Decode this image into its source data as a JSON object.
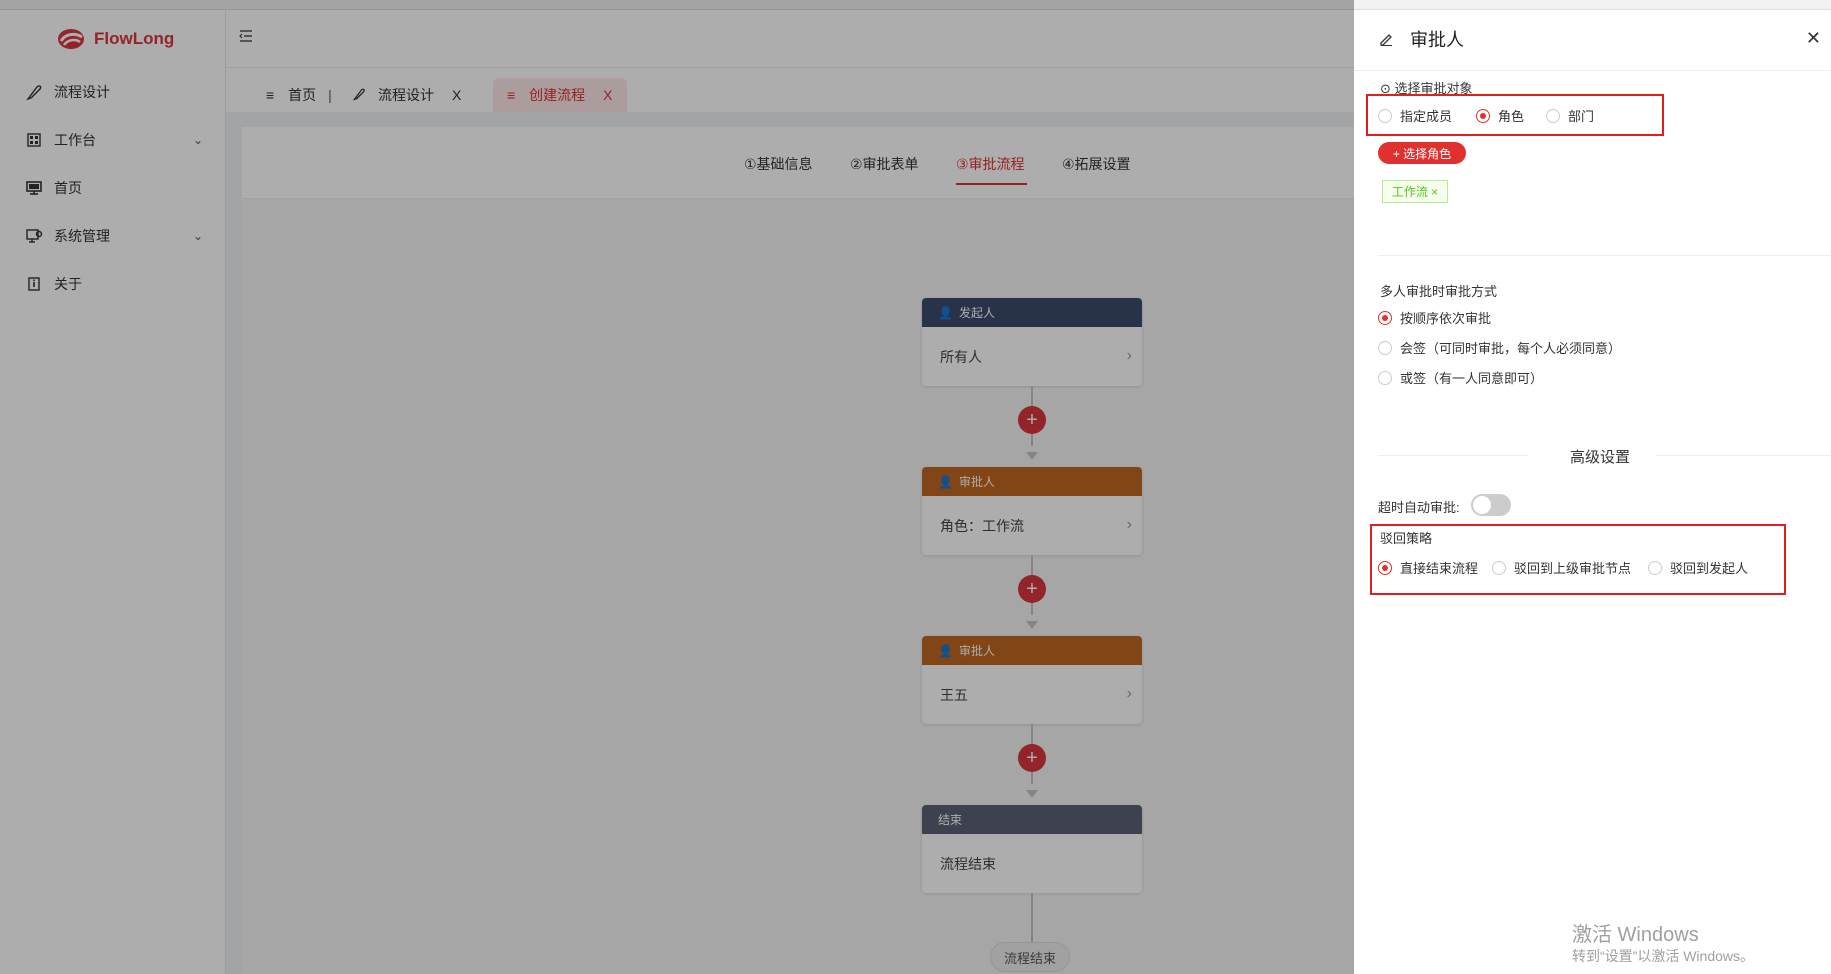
{
  "app": {
    "logo_text": "FlowLong"
  },
  "sidebar": {
    "items": [
      {
        "label": "流程设计",
        "icon": "feather-icon"
      },
      {
        "label": "工作台",
        "icon": "grid-icon",
        "expandable": true
      },
      {
        "label": "首页",
        "icon": "monitor-icon"
      },
      {
        "label": "系统管理",
        "icon": "settings-monitor-icon",
        "expandable": true
      },
      {
        "label": "关于",
        "icon": "info-icon"
      }
    ]
  },
  "tabs": [
    {
      "label": "首页"
    },
    {
      "label": "流程设计"
    },
    {
      "label": "创建流程",
      "active": true
    }
  ],
  "tab_close": "X",
  "steps": [
    "①基础信息",
    "②审批表单",
    "③审批流程",
    "④拓展设置"
  ],
  "flow": {
    "nodes": [
      {
        "type": "发起人",
        "body": "所有人",
        "color": "#3c4a6b"
      },
      {
        "type": "审批人",
        "body": "角色：工作流",
        "color": "#c0661f"
      },
      {
        "type": "审批人",
        "body": "王五",
        "color": "#c0661f"
      },
      {
        "type": "结束",
        "body": "流程结束",
        "color": "#5c6277"
      }
    ],
    "end_label": "流程结束"
  },
  "drawer": {
    "title": "审批人",
    "select_target_label": "⊙ 选择审批对象",
    "target_options": [
      "指定成员",
      "角色",
      "部门"
    ],
    "target_selected": 1,
    "select_role_button": "+ 选择角色",
    "selected_tag": "工作流 ×",
    "multi_label": "多人审批时审批方式",
    "multi_options": [
      "按顺序依次审批",
      "会签（可同时审批，每个人必须同意）",
      "或签（有一人同意即可）"
    ],
    "multi_selected": 0,
    "advanced_title": "高级设置",
    "timeout_label": "超时自动审批:",
    "timeout_enabled": false,
    "reject_label": "驳回策略",
    "reject_options": [
      "直接结束流程",
      "驳回到上级审批节点",
      "驳回到发起人"
    ],
    "reject_selected": 0
  },
  "watermark": {
    "line1": "激活 Windows",
    "line2": "转到“设置”以激活 Windows。"
  }
}
